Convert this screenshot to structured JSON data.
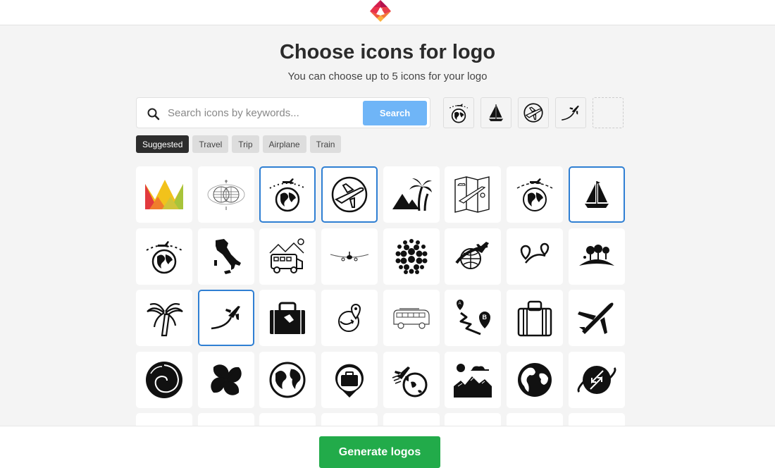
{
  "header": {
    "logo_icon": "diamond-logo-icon",
    "logo_colors": [
      "#b3124d",
      "#e8324b",
      "#f37a38",
      "#fbb03b"
    ]
  },
  "main": {
    "title": "Choose icons for logo",
    "subtitle": "You can choose up to 5 icons for your logo"
  },
  "search": {
    "placeholder": "Search icons by keywords...",
    "value": "",
    "button_label": "Search",
    "button_color": "#6fb5f7"
  },
  "selected_icons": {
    "max": 5,
    "items": [
      {
        "icon": "globe-airplane-icon"
      },
      {
        "icon": "sailboat-icon"
      },
      {
        "icon": "airplane-circle-icon"
      },
      {
        "icon": "airplane-trail-icon"
      }
    ],
    "empty_slots": 1
  },
  "chips": [
    {
      "label": "Suggested",
      "active": true
    },
    {
      "label": "Travel",
      "active": false
    },
    {
      "label": "Trip",
      "active": false
    },
    {
      "label": "Airplane",
      "active": false
    },
    {
      "label": "Train",
      "active": false
    }
  ],
  "grid": {
    "selected_color": "#2f7fd3",
    "tiles": [
      {
        "icon": "colorful-crown-mountains-icon",
        "selected": false
      },
      {
        "icon": "wire-globes-icon",
        "selected": false
      },
      {
        "icon": "globe-airplane-icon",
        "selected": true
      },
      {
        "icon": "airplane-circle-icon",
        "selected": true
      },
      {
        "icon": "palm-pyramids-icon",
        "selected": false
      },
      {
        "icon": "travel-map-icon",
        "selected": false
      },
      {
        "icon": "globe-airplane-dashed-icon",
        "selected": false
      },
      {
        "icon": "sailboat-icon",
        "selected": true
      },
      {
        "icon": "globe-airplane-orbit-icon",
        "selected": false
      },
      {
        "icon": "italy-map-icon",
        "selected": false
      },
      {
        "icon": "camper-van-mountains-icon",
        "selected": false
      },
      {
        "icon": "airliner-front-icon",
        "selected": false
      },
      {
        "icon": "dotted-sphere-icon",
        "selected": false
      },
      {
        "icon": "airplane-globe-swoosh-icon",
        "selected": false
      },
      {
        "icon": "route-pins-icon",
        "selected": false
      },
      {
        "icon": "trees-hill-icon",
        "selected": false
      },
      {
        "icon": "palm-tree-icon",
        "selected": false
      },
      {
        "icon": "airplane-trail-icon",
        "selected": true
      },
      {
        "icon": "suitcase-tag-icon",
        "selected": false
      },
      {
        "icon": "location-globe-arrow-icon",
        "selected": false
      },
      {
        "icon": "vw-bus-icon",
        "selected": false
      },
      {
        "icon": "a-to-b-route-icon",
        "selected": false
      },
      {
        "icon": "suitcase-outline-icon",
        "selected": false
      },
      {
        "icon": "airplane-icon",
        "selected": false
      },
      {
        "icon": "spiral-icon",
        "selected": false
      },
      {
        "icon": "four-petal-icon",
        "selected": false
      },
      {
        "icon": "earth-globe-icon",
        "selected": false
      },
      {
        "icon": "briefcase-pin-icon",
        "selected": false
      },
      {
        "icon": "airplane-earth-icon",
        "selected": false
      },
      {
        "icon": "mountains-sun-cloud-icon",
        "selected": false
      },
      {
        "icon": "earth-hemisphere-icon",
        "selected": false
      },
      {
        "icon": "globe-arrows-icon",
        "selected": false
      },
      {
        "icon": "partial-icon-1",
        "selected": false
      },
      {
        "icon": "partial-icon-2",
        "selected": false
      },
      {
        "icon": "partial-icon-3",
        "selected": false
      },
      {
        "icon": "partial-icon-4",
        "selected": false
      },
      {
        "icon": "partial-icon-5",
        "selected": false
      },
      {
        "icon": "partial-icon-6",
        "selected": false
      },
      {
        "icon": "partial-icon-7",
        "selected": false
      },
      {
        "icon": "partial-icon-8",
        "selected": false
      }
    ]
  },
  "footer": {
    "generate_label": "Generate logos",
    "generate_color": "#22ab4a"
  }
}
